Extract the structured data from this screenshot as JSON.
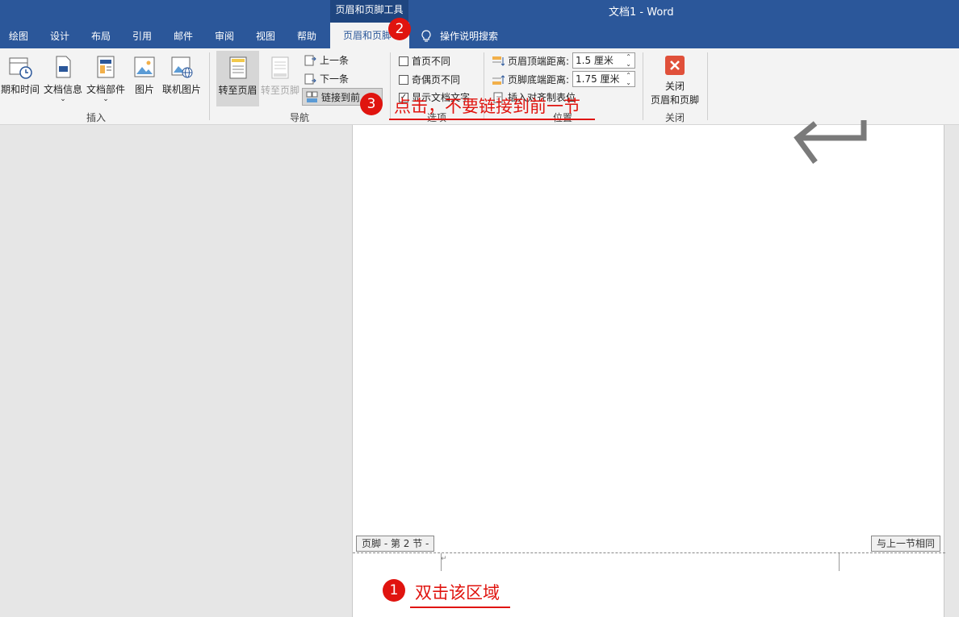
{
  "window": {
    "context_group": "页眉和页脚工具",
    "doc_title": "文档1  -  Word"
  },
  "tabs": [
    "绘图",
    "设计",
    "布局",
    "引用",
    "邮件",
    "审阅",
    "视图",
    "帮助",
    "页眉和页脚"
  ],
  "search_tab": "操作说明搜索",
  "ribbon": {
    "insert": {
      "label": "插入",
      "items": [
        "期和时间",
        "文档信息",
        "文档部件",
        "图片",
        "联机图片"
      ]
    },
    "nav": {
      "label": "导航",
      "goto_header": "转至页眉",
      "goto_footer": "转至页脚",
      "prev": "上一条",
      "next": "下一条",
      "link_prev": "链接到前"
    },
    "options": {
      "label": "选项",
      "first_page": "首页不同",
      "odd_even": "奇偶页不同",
      "show_text": "显示文档文字"
    },
    "position": {
      "label": "位置",
      "header_dist_label": "页眉顶端距离:",
      "header_dist_value": "1.5 厘米",
      "footer_dist_label": "页脚底端距离:",
      "footer_dist_value": "1.75 厘米",
      "insert_align_tab": "插入对齐制表位"
    },
    "close": {
      "label": "关闭",
      "button_line1": "关闭",
      "button_line2": "页眉和页脚"
    }
  },
  "document": {
    "footer_tag": "页脚 - 第 2 节 -",
    "same_as_prev": "与上一节相同"
  },
  "annotations": [
    {
      "num": "1",
      "text": "双击该区域"
    },
    {
      "num": "2",
      "text": ""
    },
    {
      "num": "3",
      "text": "点击，不要链接到前一节"
    }
  ],
  "colors": {
    "word_blue": "#2b579a",
    "annotation_red": "#e0140f"
  }
}
